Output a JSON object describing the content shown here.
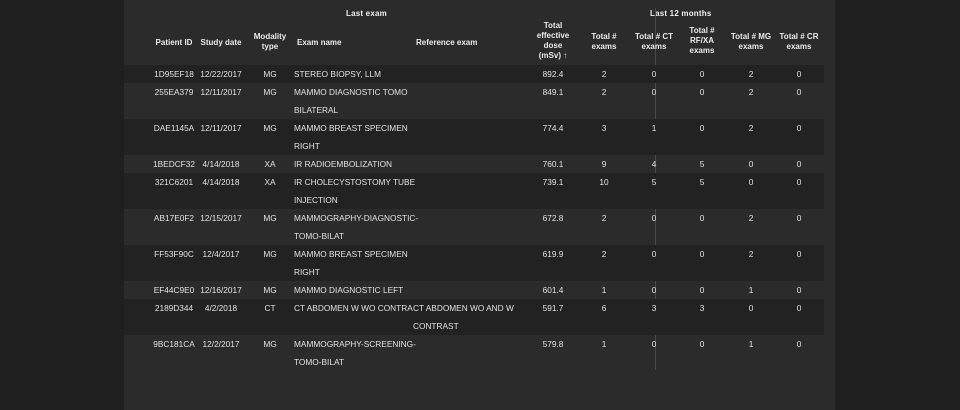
{
  "header": {
    "groups": {
      "last_exam": "Last exam",
      "last_12_months": "Last 12 months"
    },
    "columns": {
      "patient_id": "Patient ID",
      "study_date": "Study date",
      "modality_l1": "Modality",
      "modality_l2": "type",
      "exam_name": "Exam name",
      "reference_exam": "Reference exam",
      "dose_l1": "Total",
      "dose_l2": "effective",
      "dose_l3": "dose",
      "dose_l4": "(mSv)",
      "sort_indicator": "↑",
      "total_exams_l1": "Total #",
      "total_exams_l2": "exams",
      "total_ct_l1": "Total # CT",
      "total_ct_l2": "exams",
      "total_rfxa_l1": "Total #",
      "total_rfxa_l2": "RF/XA",
      "total_rfxa_l3": "exams",
      "total_mg_l1": "Total # MG",
      "total_mg_l2": "exams",
      "total_cr_l1": "Total # CR",
      "total_cr_l2": "exams"
    }
  },
  "rows": [
    {
      "patient_id": "1D95EF18",
      "study_date": "12/22/2017",
      "modality": "MG",
      "exam_l1": "STEREO BIOPSY, LLM",
      "exam_l2": "",
      "ref_l1": "",
      "ref_l2": "",
      "dose": "892.4",
      "total": "2",
      "ct": "0",
      "rfxa": "0",
      "mg": "2",
      "cr": "0"
    },
    {
      "patient_id": "255EA379",
      "study_date": "12/11/2017",
      "modality": "MG",
      "exam_l1": "MAMMO DIAGNOSTIC TOMO",
      "exam_l2": "BILATERAL",
      "ref_l1": "",
      "ref_l2": "",
      "dose": "849.1",
      "total": "2",
      "ct": "0",
      "rfxa": "0",
      "mg": "2",
      "cr": "0"
    },
    {
      "patient_id": "DAE1145A",
      "study_date": "12/11/2017",
      "modality": "MG",
      "exam_l1": "MAMMO BREAST SPECIMEN",
      "exam_l2": "RIGHT",
      "ref_l1": "",
      "ref_l2": "",
      "dose": "774.4",
      "total": "3",
      "ct": "1",
      "rfxa": "0",
      "mg": "2",
      "cr": "0"
    },
    {
      "patient_id": "1BEDCF32",
      "study_date": "4/14/2018",
      "modality": "XA",
      "exam_l1": "IR RADIOEMBOLIZATION",
      "exam_l2": "",
      "ref_l1": "",
      "ref_l2": "",
      "dose": "760.1",
      "total": "9",
      "ct": "4",
      "rfxa": "5",
      "mg": "0",
      "cr": "0"
    },
    {
      "patient_id": "321C6201",
      "study_date": "4/14/2018",
      "modality": "XA",
      "exam_l1": "IR CHOLECYSTOSTOMY TUBE",
      "exam_l2": "INJECTION",
      "ref_l1": "",
      "ref_l2": "",
      "dose": "739.1",
      "total": "10",
      "ct": "5",
      "rfxa": "5",
      "mg": "0",
      "cr": "0"
    },
    {
      "patient_id": "AB17E0F2",
      "study_date": "12/15/2017",
      "modality": "MG",
      "exam_l1": "MAMMOGRAPHY-DIAGNOSTIC-",
      "exam_l2": "TOMO-BILAT",
      "ref_l1": "",
      "ref_l2": "",
      "dose": "672.8",
      "total": "2",
      "ct": "0",
      "rfxa": "0",
      "mg": "2",
      "cr": "0"
    },
    {
      "patient_id": "FF53F90C",
      "study_date": "12/4/2017",
      "modality": "MG",
      "exam_l1": "MAMMO BREAST SPECIMEN",
      "exam_l2": "RIGHT",
      "ref_l1": "",
      "ref_l2": "",
      "dose": "619.9",
      "total": "2",
      "ct": "0",
      "rfxa": "0",
      "mg": "2",
      "cr": "0"
    },
    {
      "patient_id": "EF44C9E0",
      "study_date": "12/16/2017",
      "modality": "MG",
      "exam_l1": "MAMMO DIAGNOSTIC LEFT",
      "exam_l2": "",
      "ref_l1": "",
      "ref_l2": "",
      "dose": "601.4",
      "total": "1",
      "ct": "0",
      "rfxa": "0",
      "mg": "1",
      "cr": "0"
    },
    {
      "patient_id": "2189D344",
      "study_date": "4/2/2018",
      "modality": "CT",
      "exam_l1": "CT ABDOMEN W WO CONTRA",
      "exam_l2": "",
      "ref_l1": "CT ABDOMEN WO AND W",
      "ref_l2": "CONTRAST",
      "dose": "591.7",
      "total": "6",
      "ct": "3",
      "rfxa": "3",
      "mg": "0",
      "cr": "0"
    },
    {
      "patient_id": "9BC181CA",
      "study_date": "12/2/2017",
      "modality": "MG",
      "exam_l1": "MAMMOGRAPHY-SCREENING-",
      "exam_l2": "TOMO-BILAT",
      "ref_l1": "",
      "ref_l2": "",
      "dose": "579.8",
      "total": "1",
      "ct": "0",
      "rfxa": "0",
      "mg": "1",
      "cr": "0"
    }
  ]
}
